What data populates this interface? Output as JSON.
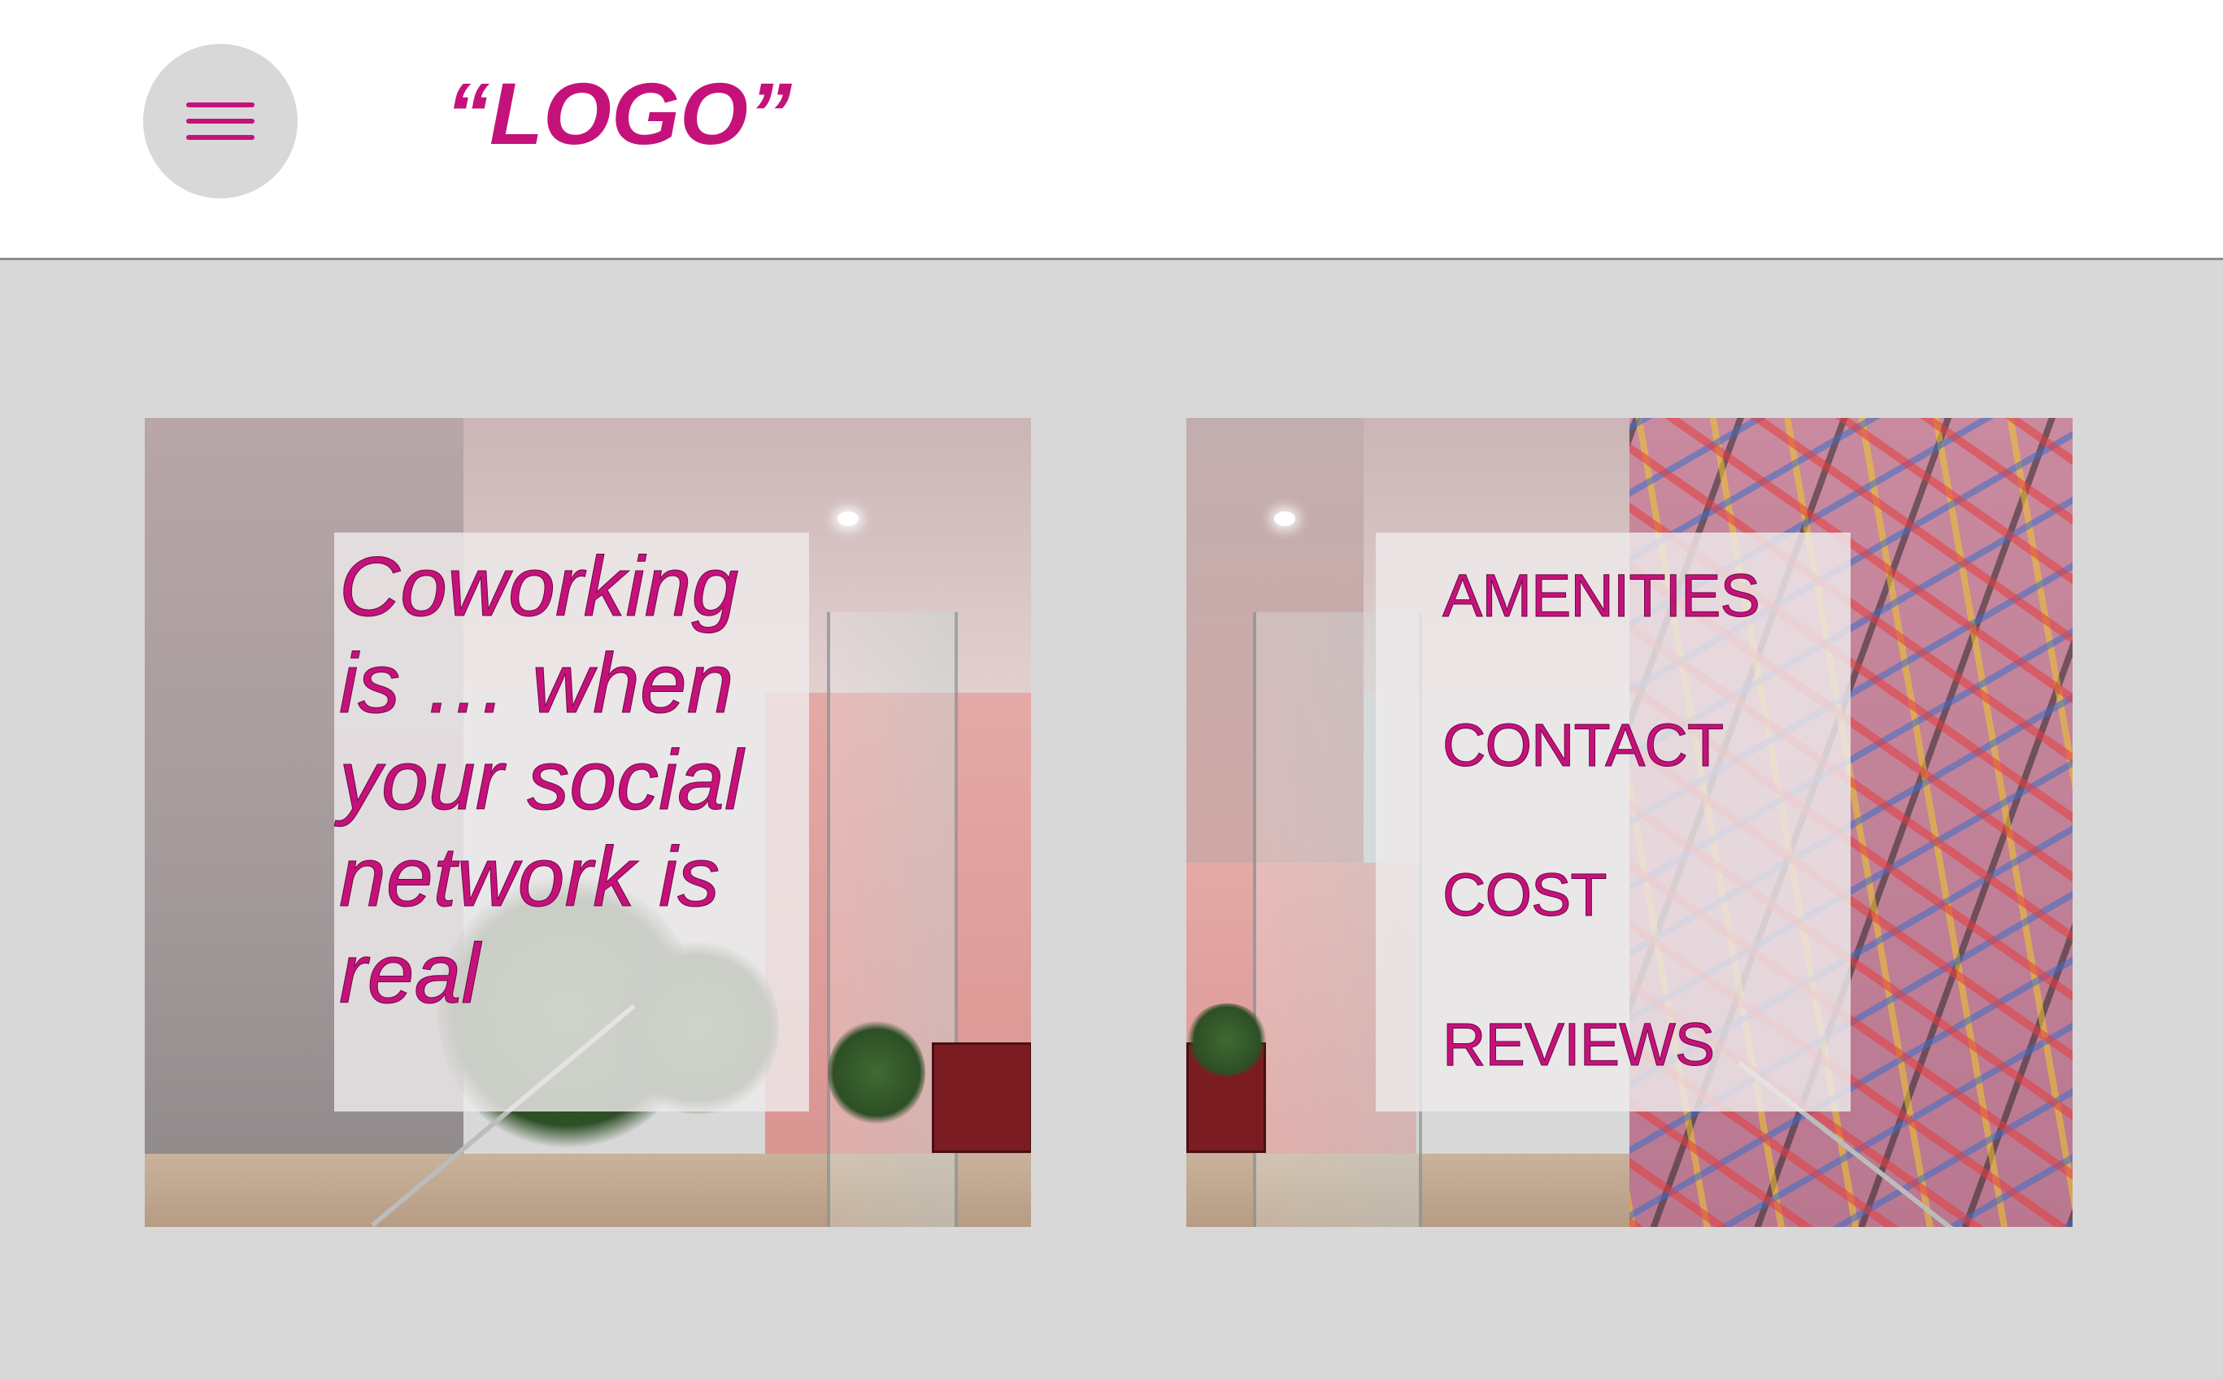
{
  "header": {
    "menu_icon": "hamburger-menu-icon",
    "logo_text": "“LOGO”"
  },
  "hero": {
    "tagline": "Coworking is … when your social network is real"
  },
  "nav": {
    "items": [
      {
        "label": "AMENITIES"
      },
      {
        "label": "CONTACT"
      },
      {
        "label": "COST"
      },
      {
        "label": "REVIEWS"
      }
    ]
  },
  "colors": {
    "accent": "#c5127b",
    "page_background": "#d8d8d8",
    "header_background": "#ffffff",
    "menu_button_background": "#d8d8d8"
  }
}
